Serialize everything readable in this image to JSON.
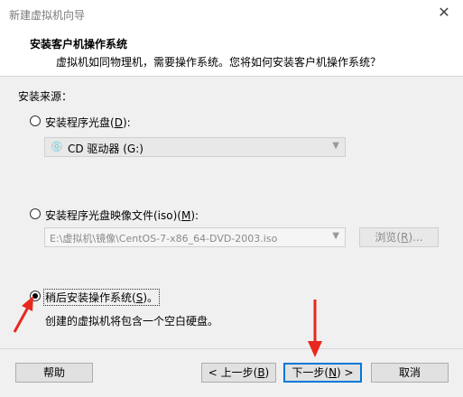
{
  "window": {
    "title": "新建虚拟机向导"
  },
  "header": {
    "title": "安装客户机操作系统",
    "subtitle": "虚拟机如同物理机，需要操作系统。您将如何安装客户机操作系统？"
  },
  "source": {
    "label": "安装来源：",
    "disc": {
      "label_pre": "安装程序光盘(",
      "key": "D",
      "label_post": "):",
      "selected": false,
      "drive": "CD 驱动器 (G:)"
    },
    "iso": {
      "label_pre": "安装程序光盘映像文件(iso)(",
      "key": "M",
      "label_post": "):",
      "selected": false,
      "path": "E:\\虚拟机\\镜像\\CentOS-7-x86_64-DVD-2003.iso",
      "browse_pre": "浏览(",
      "browse_key": "R",
      "browse_post": ")..."
    },
    "later": {
      "label_pre": "稍后安装操作系统(",
      "key": "S",
      "label_post": ")。",
      "selected": true,
      "description": "创建的虚拟机将包含一个空白硬盘。"
    }
  },
  "buttons": {
    "help": "帮助",
    "back_pre": "< 上一步(",
    "back_key": "B",
    "back_post": ")",
    "next_pre": "下一步(",
    "next_key": "N",
    "next_post": ") >",
    "cancel": "取消"
  },
  "colors": {
    "annotation_arrow": "#e8281e",
    "focus_blue": "#0078d7"
  }
}
